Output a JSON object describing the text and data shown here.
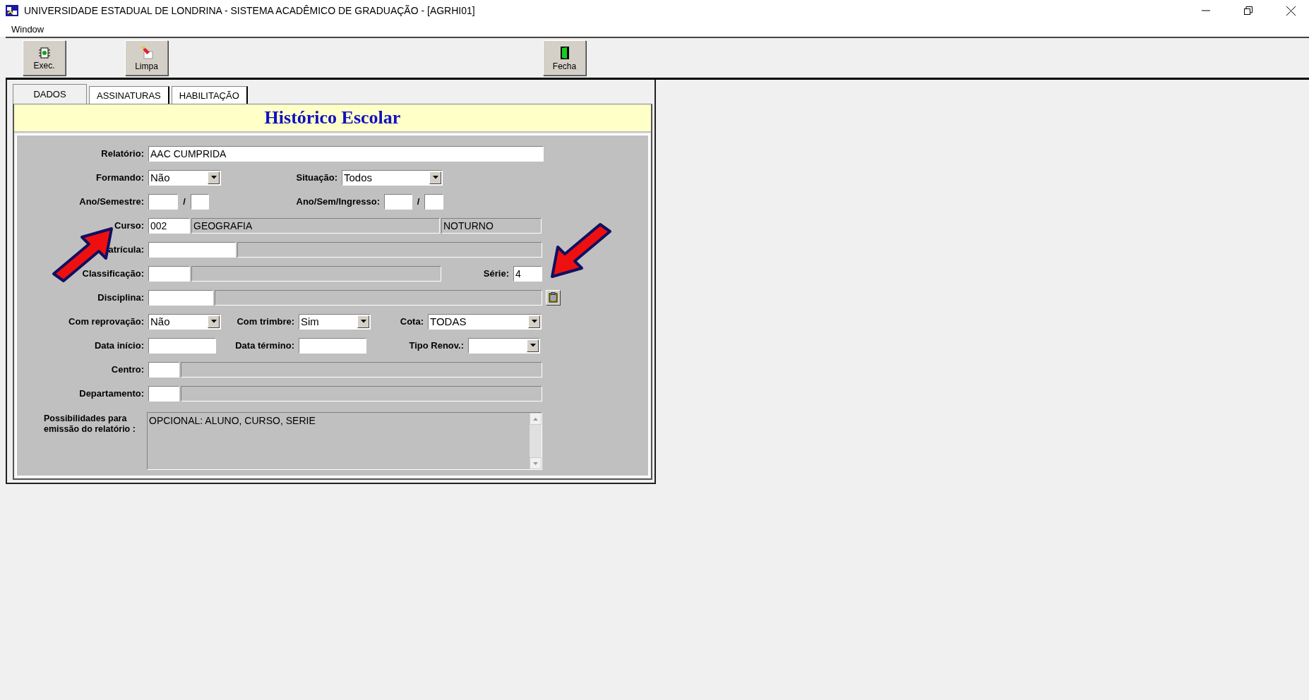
{
  "window": {
    "title": "UNIVERSIDADE ESTADUAL DE LONDRINA - SISTEMA ACADÊMICO DE GRADUAÇÃO - [AGRHI01]"
  },
  "menu": [
    "Window"
  ],
  "toolbar": [
    {
      "label": "Exec.",
      "kind": "exec"
    },
    {
      "label": "Limpa",
      "kind": "clear"
    },
    {
      "label": "Fecha",
      "kind": "close"
    }
  ],
  "tabs": [
    {
      "label": "DADOS",
      "selected": true
    },
    {
      "label": "ASSINATURAS",
      "selected": false
    },
    {
      "label": "HABILITAÇÃO",
      "selected": false
    }
  ],
  "form": {
    "title": "Histórico Escolar",
    "rows": [
      [
        {
          "kind": "label",
          "text": "Relatório:"
        },
        {
          "kind": "input",
          "value": "AAC CUMPRIDA"
        }
      ],
      [
        {
          "kind": "label",
          "text": "Formando:"
        },
        {
          "kind": "select",
          "value": "Não"
        },
        {
          "kind": "label",
          "text": "Situação:"
        },
        {
          "kind": "select",
          "value": "Todos"
        }
      ],
      [
        {
          "kind": "label",
          "text": "Ano/Semestre:"
        },
        {
          "kind": "input"
        },
        {
          "kind": "slash",
          "text": "/"
        },
        {
          "kind": "input"
        },
        {
          "kind": "label",
          "text": "Ano/Sem/Ingresso:"
        },
        {
          "kind": "input"
        },
        {
          "kind": "slash",
          "text": "/"
        },
        {
          "kind": "input"
        }
      ],
      [
        {
          "kind": "label",
          "text": "Curso:"
        },
        {
          "kind": "input",
          "value": "002"
        },
        {
          "kind": "display",
          "value": "GEOGRAFIA"
        },
        {
          "kind": "display",
          "value": "NOTURNO"
        }
      ],
      [
        {
          "kind": "label",
          "text": "atrícula:"
        },
        {
          "kind": "input"
        },
        {
          "kind": "display"
        }
      ],
      [
        {
          "kind": "label",
          "text": "Classificação:"
        },
        {
          "kind": "input"
        },
        {
          "kind": "display"
        },
        {
          "kind": "label",
          "text": "Série:"
        },
        {
          "kind": "input",
          "value": "4"
        }
      ],
      [
        {
          "kind": "label",
          "text": "Disciplina:"
        },
        {
          "kind": "input"
        },
        {
          "kind": "display"
        },
        {
          "kind": "button"
        }
      ],
      [
        {
          "kind": "label",
          "text": "Com reprovação:"
        },
        {
          "kind": "select",
          "value": "Não"
        },
        {
          "kind": "label",
          "text": "Com trimbre:"
        },
        {
          "kind": "select",
          "value": "Sim"
        },
        {
          "kind": "label",
          "text": "Cota:"
        },
        {
          "kind": "select",
          "value": "TODAS"
        }
      ],
      [
        {
          "kind": "label",
          "text": "Data início:"
        },
        {
          "kind": "input"
        },
        {
          "kind": "label",
          "text": "Data término:"
        },
        {
          "kind": "input"
        },
        {
          "kind": "label",
          "text": "Tipo Renov.:"
        },
        {
          "kind": "select"
        }
      ],
      [
        {
          "kind": "label",
          "text": "Centro:"
        },
        {
          "kind": "input"
        },
        {
          "kind": "display"
        }
      ],
      [
        {
          "kind": "label",
          "text": "Departamento:"
        },
        {
          "kind": "input"
        },
        {
          "kind": "display"
        }
      ]
    ],
    "memo": {
      "label_lines": [
        "Possibilidades para",
        "emissão do relatório :"
      ],
      "value": "OPCIONAL: ALUNO, CURSO, SERIE"
    }
  }
}
